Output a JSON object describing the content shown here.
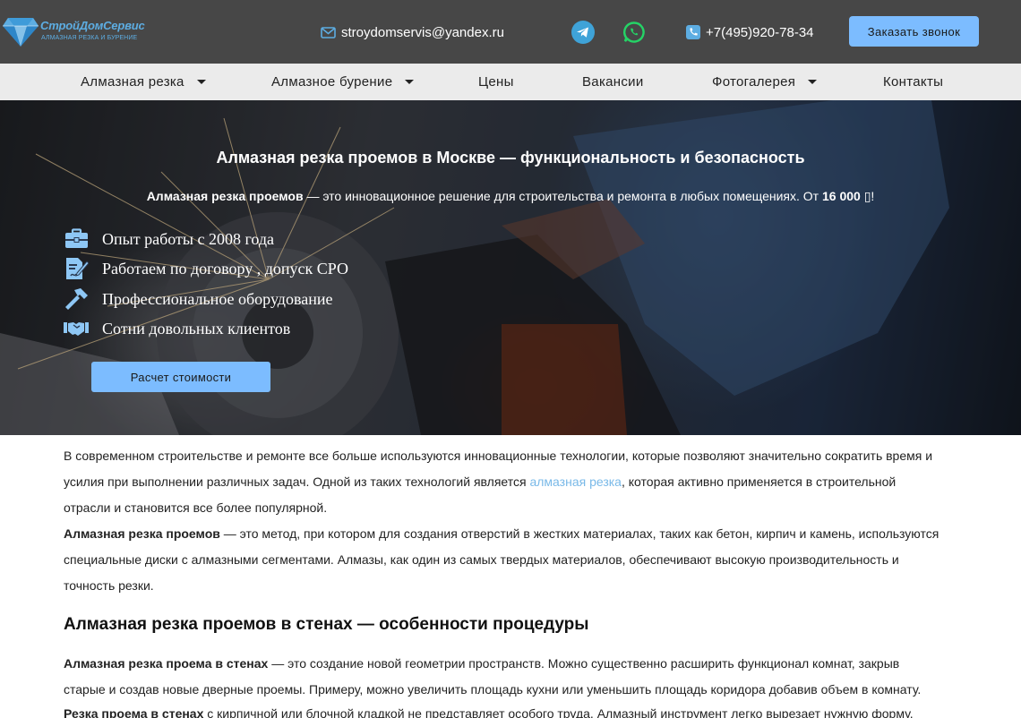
{
  "header": {
    "logo_title": "СтройДомСервис",
    "logo_subtitle": "АЛМАЗНАЯ РЕЗКА И БУРЕНИЕ",
    "email": "stroydomservis@yandex.ru",
    "phone": "+7(495)920-78-34",
    "call_button": "Заказать звонок",
    "social_icons": [
      "telegram-icon",
      "whatsapp-icon"
    ]
  },
  "nav": {
    "items": [
      {
        "label": "Алмазная резка",
        "has_dropdown": true
      },
      {
        "label": "Алмазное бурение",
        "has_dropdown": true
      },
      {
        "label": "Цены",
        "has_dropdown": false
      },
      {
        "label": "Вакансии",
        "has_dropdown": false
      },
      {
        "label": "Фотогалерея",
        "has_dropdown": true
      },
      {
        "label": "Контакты",
        "has_dropdown": false
      }
    ]
  },
  "hero": {
    "title": "Алмазная резка проемов в Москве — функциональность и безопасность",
    "subtitle_bold": "Алмазная резка проемов",
    "subtitle_text": " — это инновационное решение для строительства и ремонта в любых помещениях. От ",
    "price": "16 000",
    "currency_glyph": "▯",
    "subtitle_end": "!",
    "features": [
      {
        "icon": "briefcase-icon",
        "text": "Опыт работы с 2008 года"
      },
      {
        "icon": "contract-icon",
        "text": "Работаем по договору , допуск СРО"
      },
      {
        "icon": "hammer-icon",
        "text": "Профессиональное оборудование"
      },
      {
        "icon": "handshake-icon",
        "text": "Сотни довольных клиентов"
      }
    ],
    "cta_button": "Расчет стоимости"
  },
  "article": {
    "p1_line1": "В современном строительстве и ремонте все больше используются инновационные технологии, которые позволяют значительно сократить время и",
    "p1_line2_a": "усилия при выполнении различных задач. Одной из таких технологий является ",
    "p1_link": "алмазная резка",
    "p1_line2_b": ", которая активно применяется в строительной",
    "p1_line3": "отрасли и становится все более популярной.",
    "p2_bold": "Алмазная резка проемов",
    "p2_line1": " — это метод, при котором для создания отверстий в жестких материалах, таких как бетон, кирпич и камень, используются",
    "p2_line2": "специальные диски с алмазными сегментами. Алмазы, как один из самых твердых материалов, обеспечивают высокую производительность и",
    "p2_line3": "точность резки.",
    "h2": "Алмазная резка проемов в стенах — особенности процедуры",
    "p3_bold": "Алмазная резка проема в стенах",
    "p3_line1": " — это создание новой геометрии пространств. Можно существенно расширить функционал комнат, закрыв",
    "p3_line2": "старые и создав новые дверные проемы. Примеру, можно увеличить площадь кухни или уменьшить площадь коридора добавив объем в комнату.",
    "p4_bold": "Резка проема в стенах",
    "p4_line1": " с кирпичной или блочной кладкой не представляет особого труда. Алмазный инструмент легко вырезает нужную форму."
  }
}
